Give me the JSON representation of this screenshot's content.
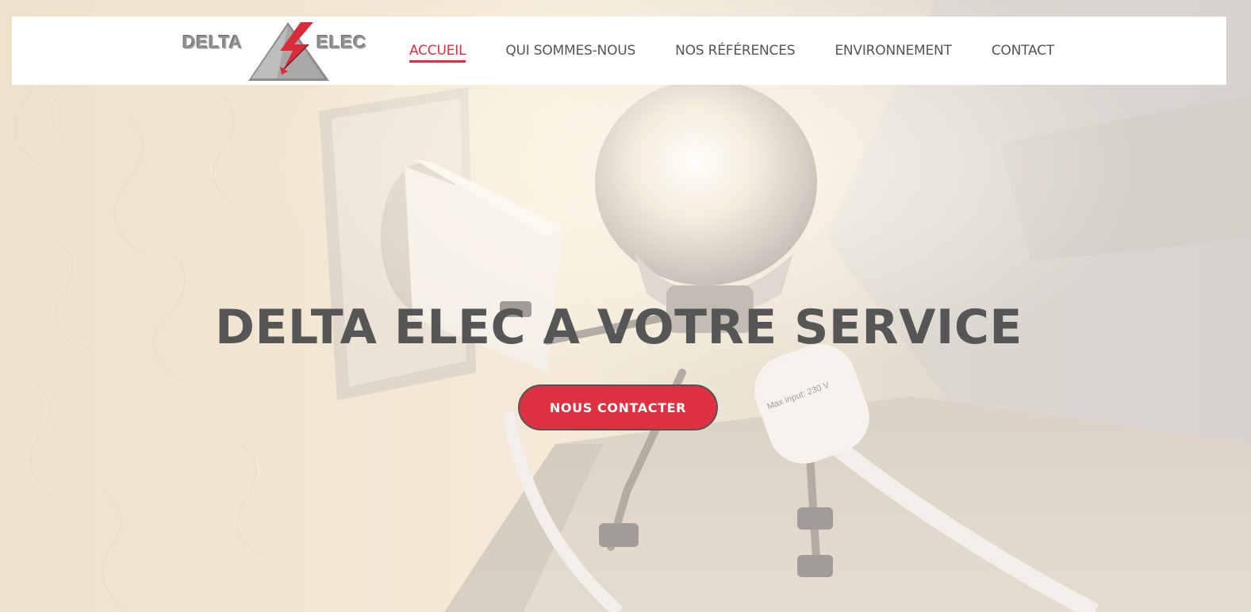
{
  "logo": {
    "word_left": "DELTA",
    "word_right": "ELEC",
    "triangle_color": "#9a9a9a",
    "bolt_color": "#d92b3a"
  },
  "nav": {
    "items": [
      {
        "label": "ACCUEIL",
        "active": true
      },
      {
        "label": "QUI SOMMES-NOUS",
        "active": false
      },
      {
        "label": "NOS RÉFÉRENCES",
        "active": false
      },
      {
        "label": "ENVIRONNEMENT",
        "active": false
      },
      {
        "label": "CONTACT",
        "active": false
      }
    ],
    "active_color": "#d93040"
  },
  "hero": {
    "title": "DELTA ELEC A VOTRE SERVICE",
    "cta_label": "NOUS CONTACTER",
    "cta_color": "#de3142",
    "bulb_label": "Max input: 230 V"
  }
}
